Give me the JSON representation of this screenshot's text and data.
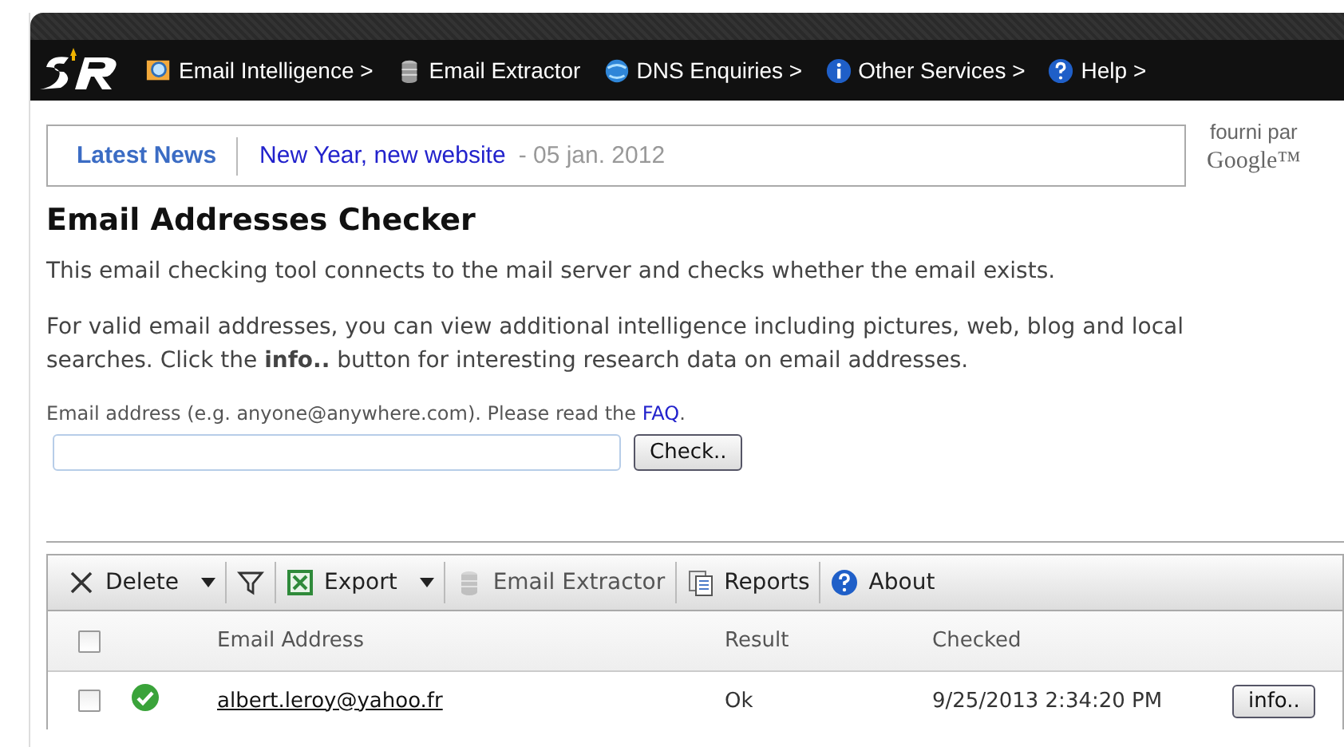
{
  "nav": {
    "items": [
      {
        "label": "Email Intelligence >"
      },
      {
        "label": "Email Extractor"
      },
      {
        "label": "DNS Enquiries >"
      },
      {
        "label": "Other Services >"
      },
      {
        "label": "Help >"
      }
    ]
  },
  "news": {
    "label": "Latest News",
    "headline": "New Year, new website",
    "date": "- 05 jan. 2012"
  },
  "powered": {
    "text": "fourni par",
    "brand": "Google™"
  },
  "title": "Email Addresses Checker",
  "paragraphs": [
    "This email checking tool connects to the mail server and checks whether the email exists.",
    "For valid email addresses, you can view additional intelligence including pictures, web, blog and local searches. Click the **info..** button for interesting research data on email addresses."
  ],
  "form": {
    "label": "Email address (e.g. anyone@anywhere.com). Please read the",
    "link": "FAQ",
    "after": ".",
    "button": "Check.."
  },
  "toolbar": [
    {
      "label": "Delete",
      "dropdown": true,
      "disabled": false
    },
    {
      "dropdown": false,
      "disabled": false
    },
    {
      "label": "Export",
      "dropdown": true,
      "disabled": false
    },
    {
      "label": "Email Extractor",
      "dropdown": false,
      "disabled": true
    },
    {
      "label": "Reports",
      "dropdown": false,
      "disabled": false
    },
    {
      "label": "About",
      "dropdown": false,
      "disabled": false
    }
  ],
  "table": {
    "columns": [
      "Email Address",
      "Result",
      "Checked"
    ],
    "header_checked": false,
    "rows": [
      {
        "checked": false,
        "kind": "ok",
        "email": "albert.leroy@yahoo.fr",
        "result": "Ok",
        "checked_at": "9/25/2013 2:34:20 PM",
        "button": "info.."
      }
    ]
  }
}
